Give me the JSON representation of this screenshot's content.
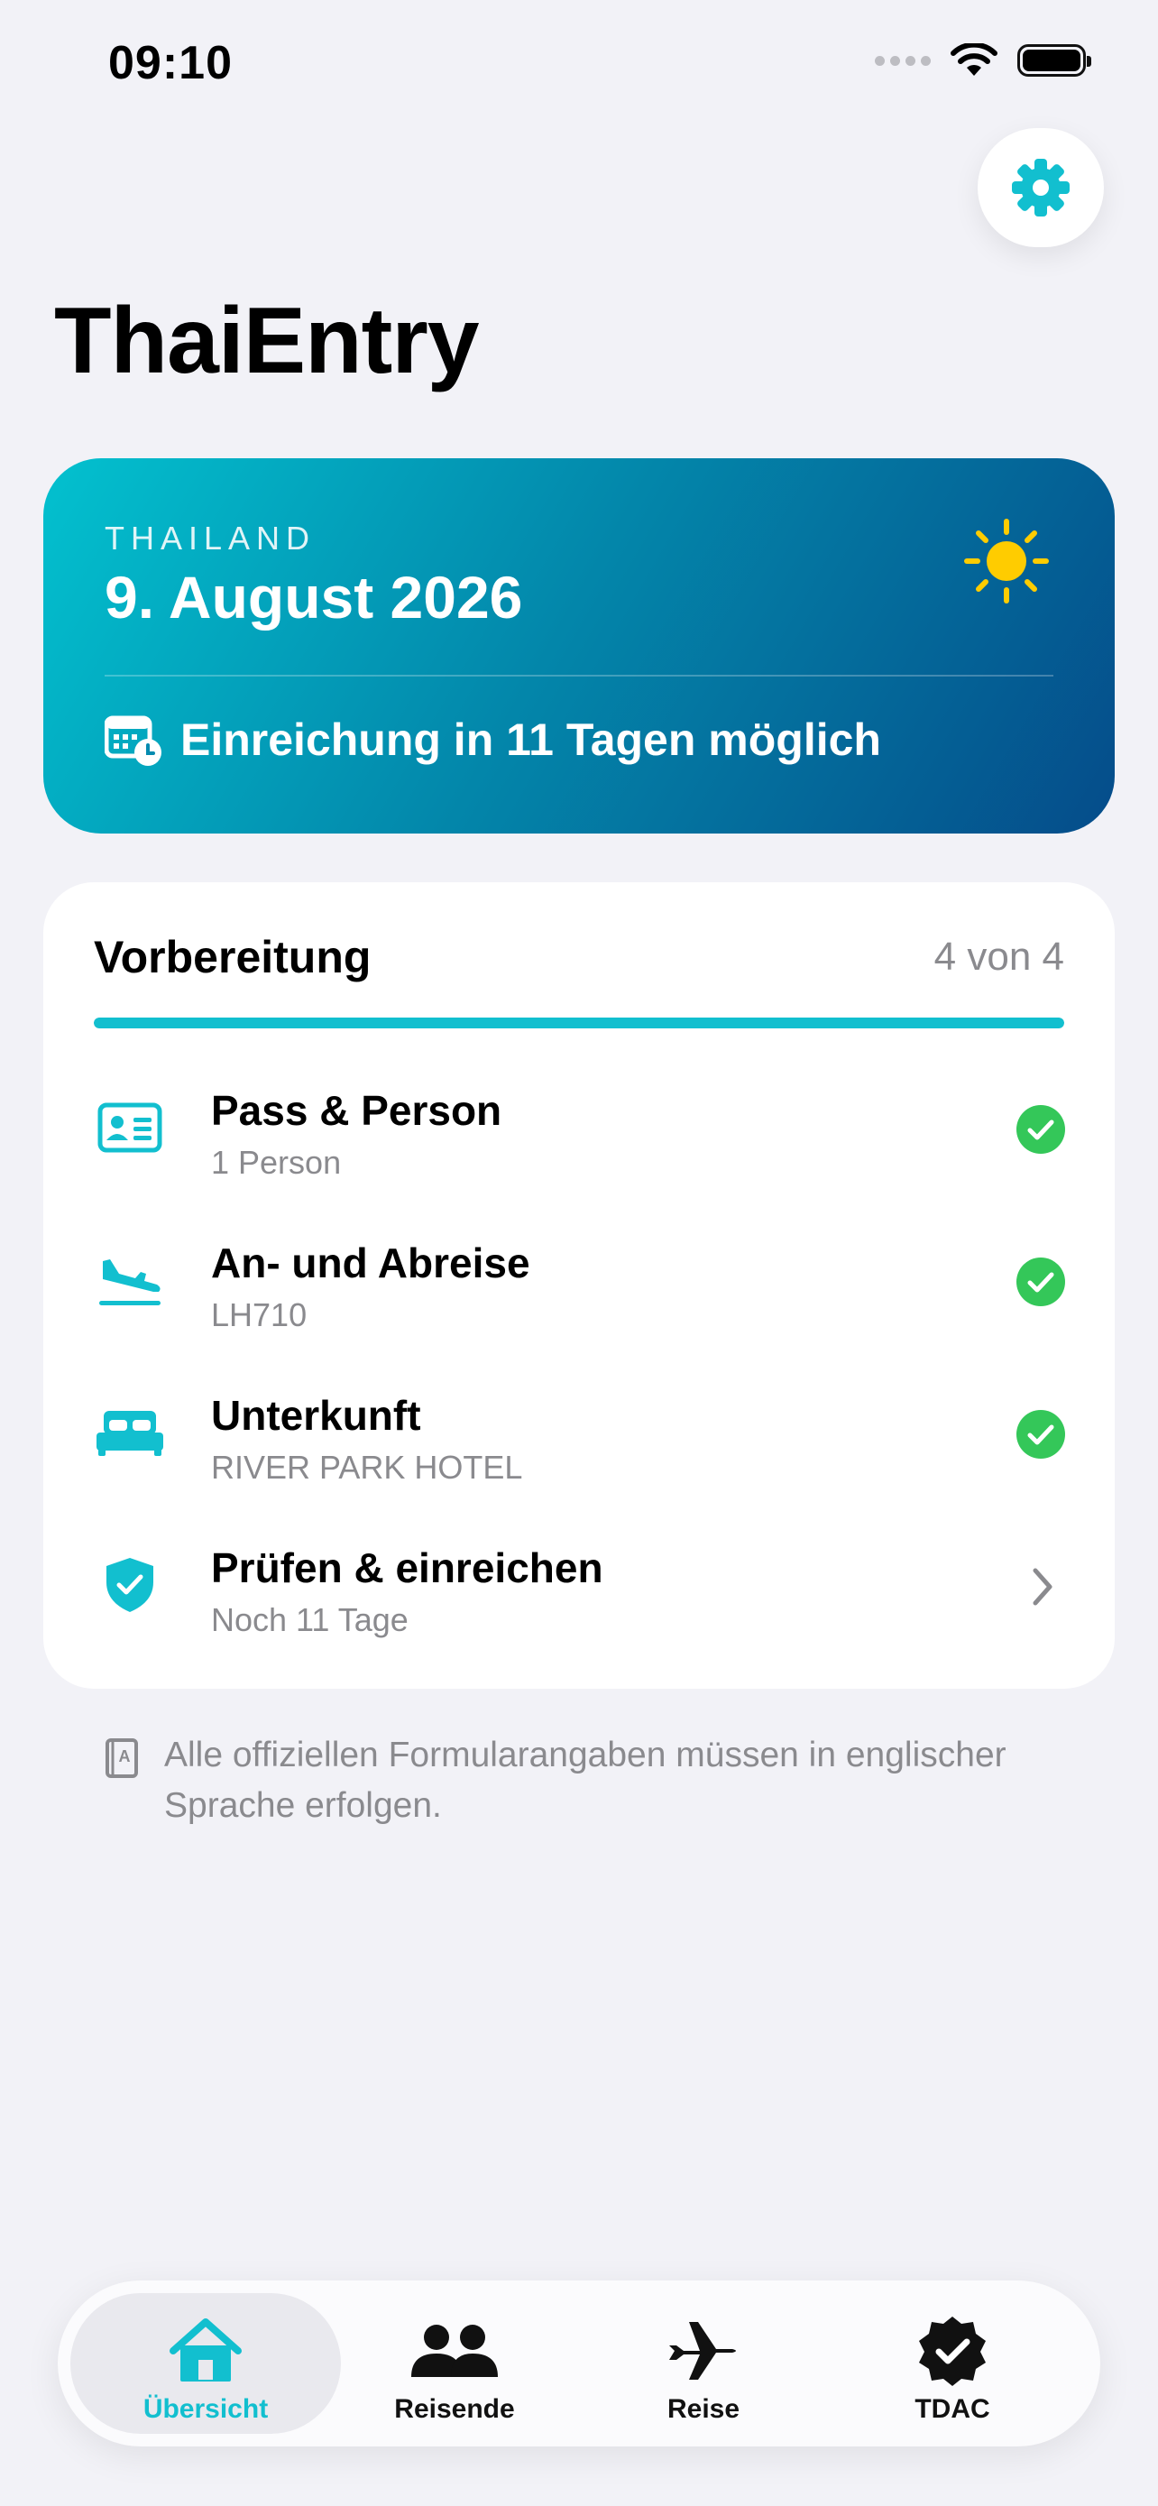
{
  "status_bar": {
    "time": "09:10"
  },
  "app": {
    "title": "ThaiEntry"
  },
  "hero": {
    "country": "THAILAND",
    "date": "9. August 2026",
    "submission_note": "Einreichung in 11 Tagen möglich",
    "icon": "sun-icon"
  },
  "checklist": {
    "title": "Vorbereitung",
    "count": "4 von 4",
    "progress": 1.0,
    "items": [
      {
        "title": "Pass & Person",
        "subtitle": "1 Person",
        "icon": "id-card-icon",
        "status": "done"
      },
      {
        "title": "An- und Abreise",
        "subtitle": "LH710",
        "icon": "plane-arrival-icon",
        "status": "done"
      },
      {
        "title": "Unterkunft",
        "subtitle": "RIVER PARK HOTEL",
        "icon": "bed-icon",
        "status": "done"
      },
      {
        "title": "Prüfen & einreichen",
        "subtitle": "Noch 11 Tage",
        "icon": "shield-check-icon",
        "status": "open"
      }
    ]
  },
  "info_note": {
    "text": "Alle offiziellen Formularangaben müssen in englischer Sprache erfolgen.",
    "icon": "dictionary-icon"
  },
  "tabs": [
    {
      "label": "Übersicht",
      "icon": "house-icon",
      "active": true
    },
    {
      "label": "Reisende",
      "icon": "people-icon",
      "active": false
    },
    {
      "label": "Reise",
      "icon": "airplane-icon",
      "active": false
    },
    {
      "label": "TDAC",
      "icon": "seal-check-icon",
      "active": false
    }
  ],
  "colors": {
    "accent": "#12BFCF",
    "success": "#34C759",
    "hero_start": "#03C1CF",
    "hero_end": "#054C8A",
    "sun": "#FFCC00"
  }
}
